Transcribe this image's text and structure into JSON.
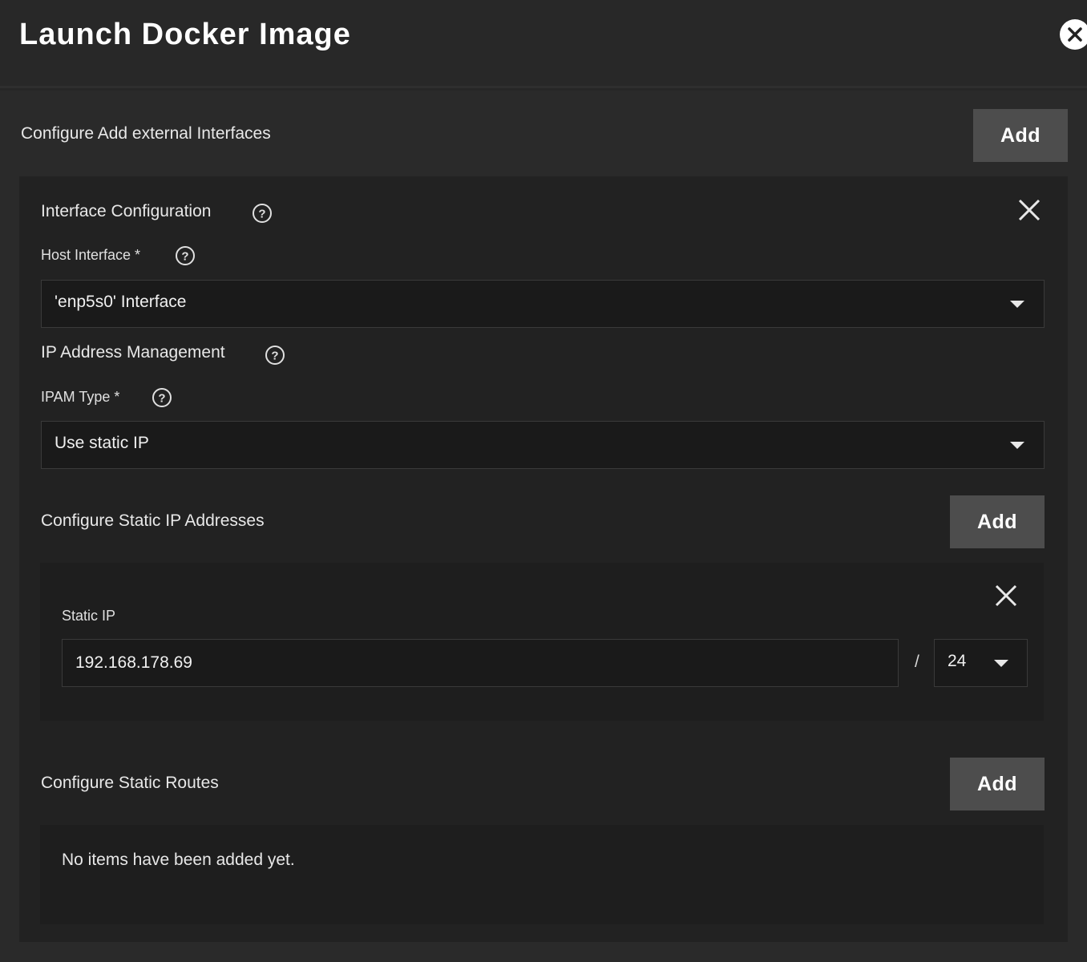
{
  "dialog": {
    "title": "Launch Docker Image"
  },
  "external_interfaces": {
    "section_label": "Configure Add external Interfaces",
    "add_label": "Add"
  },
  "interface_config": {
    "heading": "Interface Configuration",
    "host_interface": {
      "label": "Host Interface *",
      "value": "'enp5s0' Interface"
    },
    "ipam_heading": "IP Address Management",
    "ipam_type": {
      "label": "IPAM Type *",
      "value": "Use static IP"
    },
    "static_ips": {
      "section_label": "Configure Static IP Addresses",
      "add_label": "Add",
      "item": {
        "label": "Static IP",
        "address": "192.168.178.69",
        "separator": "/",
        "prefix": "24"
      }
    },
    "static_routes": {
      "section_label": "Configure Static Routes",
      "add_label": "Add",
      "empty_message": "No items have been added yet."
    }
  },
  "icons": {
    "dialog_close": "close-circle-icon",
    "remove": "close-icon",
    "help": "help-circle-icon",
    "dropdown": "caret-down-icon"
  },
  "colors": {
    "background": "#262626",
    "panel": "#222222",
    "button": "#4d4d4d",
    "text": "#ffffff"
  }
}
